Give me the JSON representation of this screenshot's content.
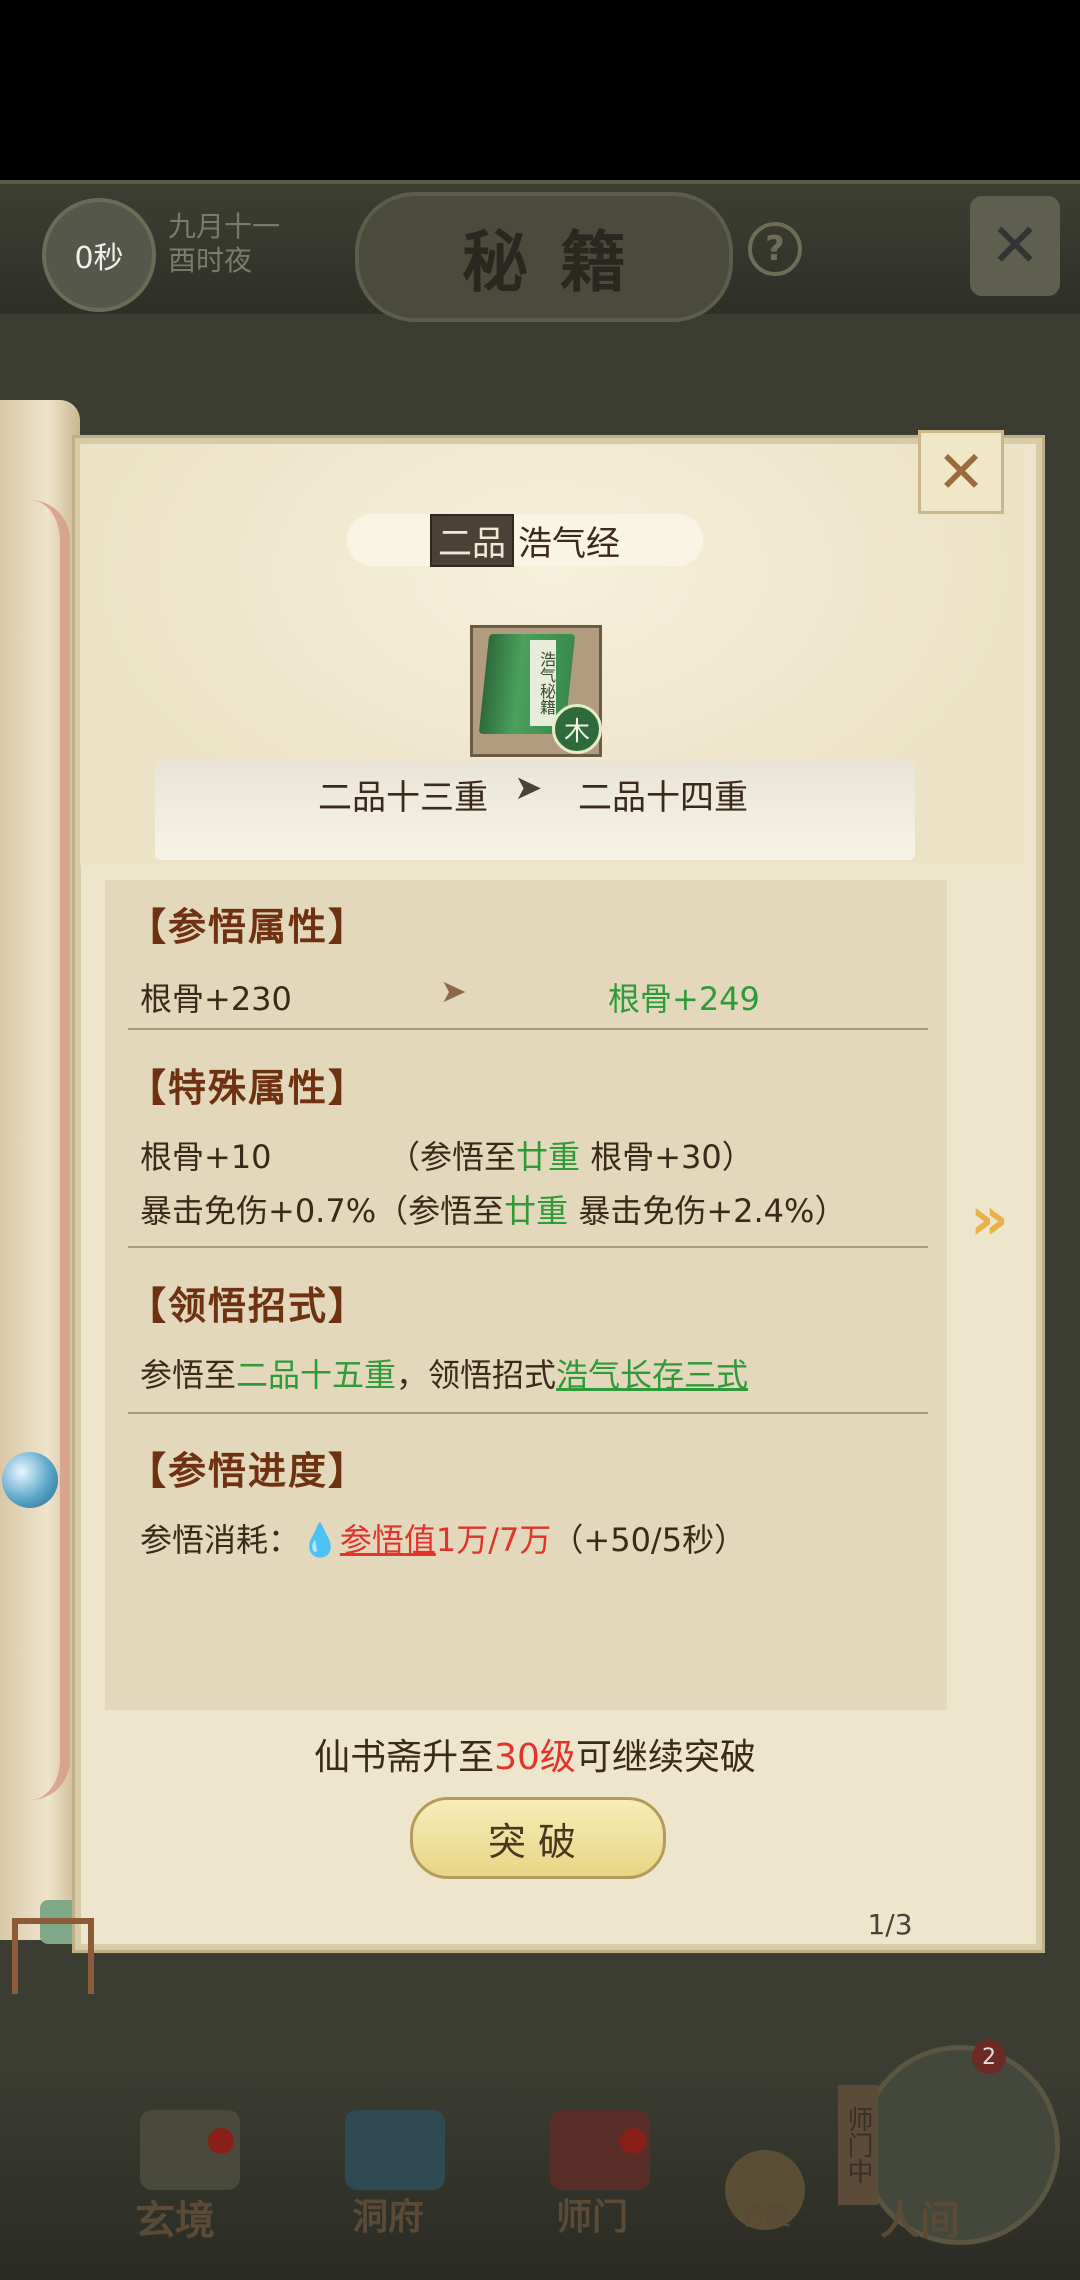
{
  "topbar": {
    "timer": "0秒",
    "date_line1": "九月十一",
    "date_line2": "酉时夜",
    "title": "秘籍",
    "help_icon": "question-icon",
    "close_icon": "close-icon"
  },
  "modal": {
    "grade_badge": "二品",
    "book_name": "浩气经",
    "book_label": "浩气秘籍",
    "element": "木",
    "tier_from": "二品十三重",
    "tier_arrow": "➤",
    "tier_to": "二品十四重",
    "sections": {
      "comprehend_attr": {
        "title": "【参悟属性】",
        "current": "根骨+230",
        "arrow": "➤",
        "next": "根骨+249"
      },
      "special_attr": {
        "title": "【特殊属性】",
        "row1_value": "根骨+10",
        "row1_note_pre": "（参悟至",
        "row1_note_green": "廿重",
        "row1_note_post": " 根骨+30）",
        "row2_value": "暴击免伤+0.7%",
        "row2_note_pre": "（参悟至",
        "row2_note_green": "廿重",
        "row2_note_post": " 暴击免伤+2.4%）"
      },
      "skill": {
        "title": "【领悟招式】",
        "pre": "参悟至",
        "tier_green": "二品十五重",
        "mid": "，领悟招式",
        "skill_link": "浩气长存三式"
      },
      "progress": {
        "title": "【参悟进度】",
        "label": "参悟消耗：",
        "cost_link": "参悟值",
        "cost_amount": "1万/7万",
        "rate": "（+50/5秒）"
      }
    },
    "requirement_pre": "仙书斋升至",
    "requirement_level": "30级",
    "requirement_post": "可继续突破",
    "break_button": "突破",
    "page_indicator": "1/3"
  },
  "bottom_nav": {
    "items": [
      "玄境",
      "洞府",
      "师门",
      "行囊",
      "人间"
    ],
    "master_label": "师门中",
    "master_badge": "2"
  },
  "colors": {
    "accent_green": "#2e9a3a",
    "accent_red": "#e0342c",
    "section_title": "#6e3213"
  }
}
